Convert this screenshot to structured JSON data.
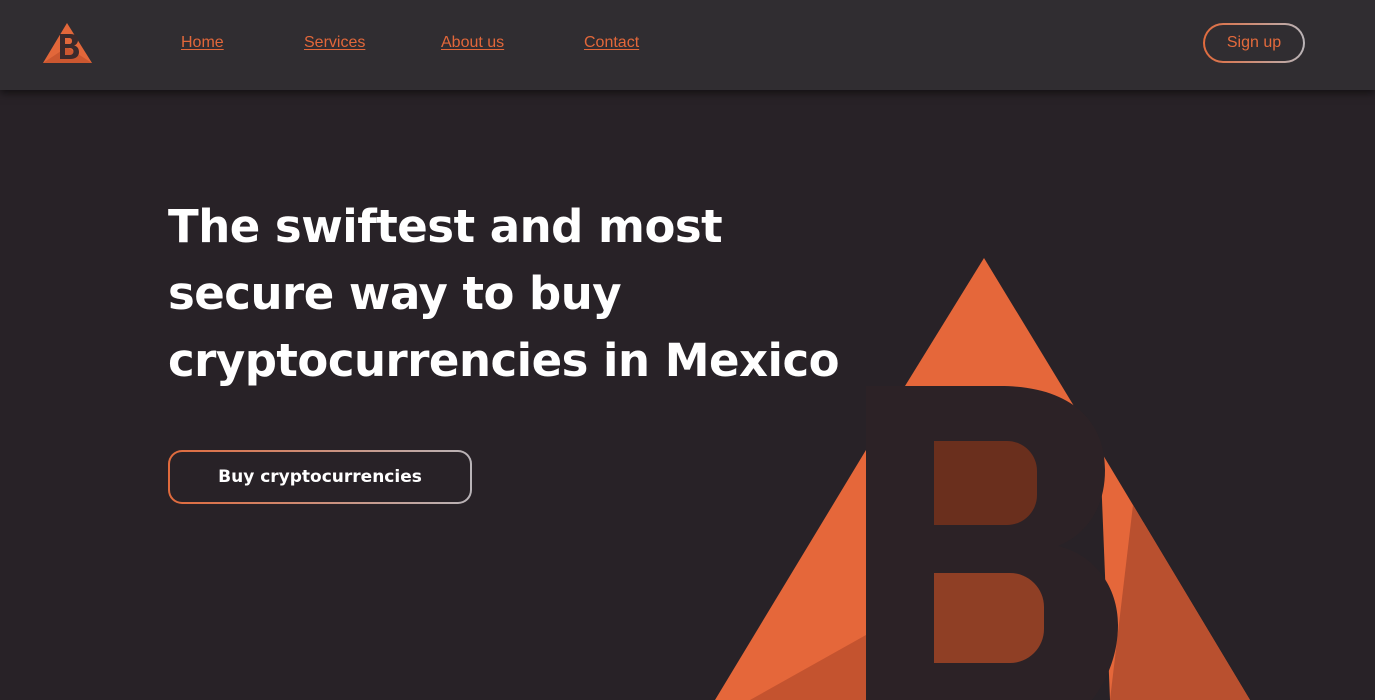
{
  "header": {
    "logo_icon": "bitso-b-triangle-logo",
    "nav": [
      {
        "label": "Home"
      },
      {
        "label": "Services"
      },
      {
        "label": "About us"
      },
      {
        "label": "Contact"
      }
    ],
    "signup_label": "Sign up"
  },
  "hero": {
    "title_lines": [
      "The swiftest and most",
      "secure way to buy",
      "cryptocurrencies in Mexico"
    ],
    "cta_label": "Buy cryptocurrencies",
    "graphic_icon": "large-b-triangle-logo"
  },
  "colors": {
    "accent": "#e2673a",
    "background": "#282227",
    "header_background": "#302d31",
    "text": "#ffffff",
    "border_gradient_end": "#b9b4b8"
  }
}
